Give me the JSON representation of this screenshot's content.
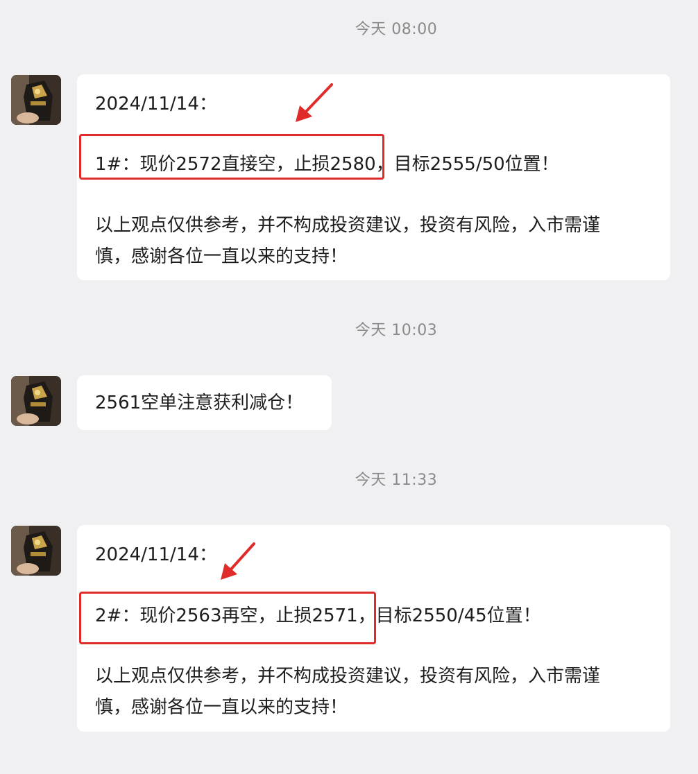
{
  "messages": [
    {
      "timestamp": "今天 08:00",
      "lines": [
        "2024/11/14：",
        "1#：现价2572直接空，止损2580，目标2555/50位置！",
        "以上观点仅供参考，并不构成投资建议，投资有风险，入市需谨",
        "慎，感谢各位一直以来的支持！"
      ]
    },
    {
      "timestamp": "今天 10:03",
      "lines": [
        "2561空单注意获利减仓！"
      ]
    },
    {
      "timestamp": "今天 11:33",
      "lines": [
        "2024/11/14：",
        "2#：现价2563再空，止损2571，目标2550/45位置！",
        "以上观点仅供参考，并不构成投资建议，投资有风险，入市需谨",
        "慎，感谢各位一直以来的支持！"
      ]
    }
  ],
  "colors": {
    "background": "#f0f0f2",
    "bubble": "#ffffff",
    "timestamp_text": "#8a8a8a",
    "annotation_red": "#e02b2b"
  },
  "icons": [
    "avatar-image",
    "red-arrow-annotation",
    "red-highlight-box"
  ]
}
